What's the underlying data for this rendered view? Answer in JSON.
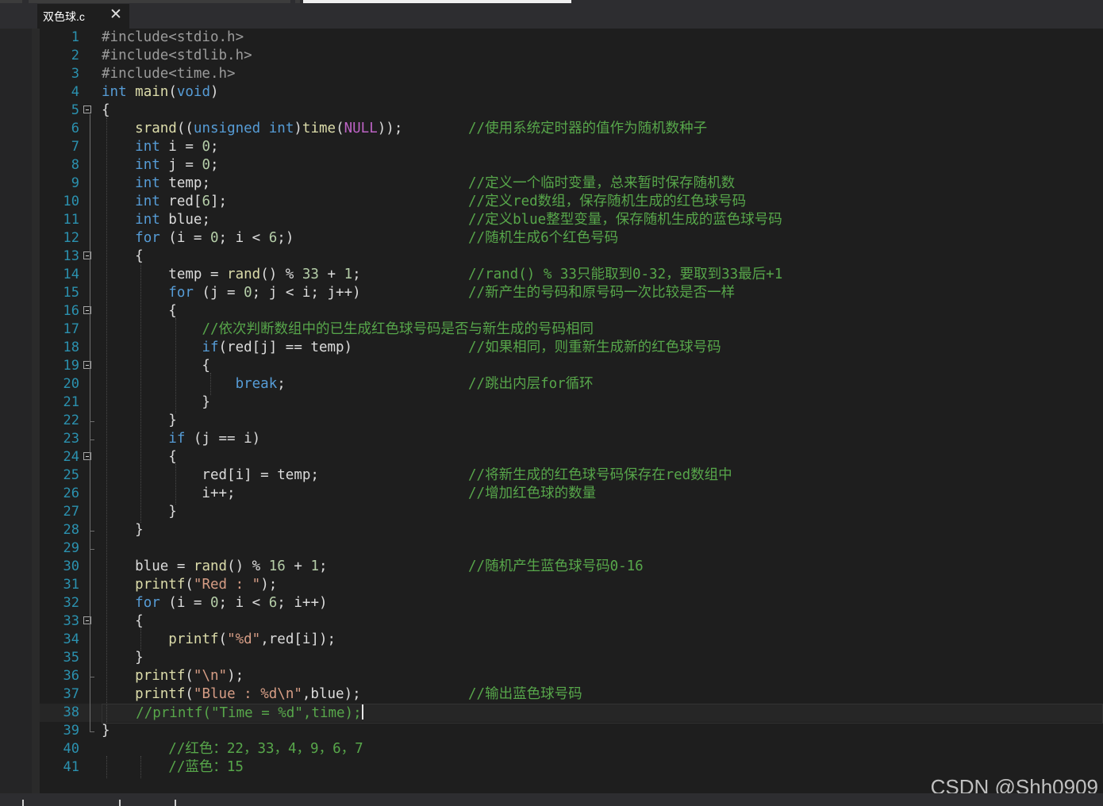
{
  "tab": {
    "label": "双色球.c",
    "close_icon": "close-icon"
  },
  "lines": [
    {
      "n": "1",
      "tokens": [
        [
          "pp",
          "#include<stdio.h>"
        ]
      ],
      "comment": ""
    },
    {
      "n": "2",
      "tokens": [
        [
          "pp",
          "#include<stdlib.h>"
        ]
      ],
      "comment": ""
    },
    {
      "n": "3",
      "tokens": [
        [
          "pp",
          "#include<time.h>"
        ]
      ],
      "comment": ""
    },
    {
      "n": "4",
      "tokens": [
        [
          "kw",
          "int"
        ],
        [
          "txt",
          " "
        ],
        [
          "fn",
          "main"
        ],
        [
          "txt",
          "("
        ],
        [
          "kw",
          "void"
        ],
        [
          "txt",
          ")"
        ]
      ],
      "comment": ""
    },
    {
      "n": "5",
      "tokens": [
        [
          "txt",
          "{"
        ]
      ],
      "comment": ""
    },
    {
      "n": "6",
      "tokens": [
        [
          "txt",
          "    "
        ],
        [
          "fn",
          "srand"
        ],
        [
          "txt",
          "(("
        ],
        [
          "kw",
          "unsigned int"
        ],
        [
          "txt",
          ")"
        ],
        [
          "fn",
          "time"
        ],
        [
          "txt",
          "("
        ],
        [
          "mac",
          "NULL"
        ],
        [
          "txt",
          "));"
        ]
      ],
      "comment": "//使用系统定时器的值作为随机数种子"
    },
    {
      "n": "7",
      "tokens": [
        [
          "txt",
          "    "
        ],
        [
          "kw",
          "int"
        ],
        [
          "txt",
          " i = "
        ],
        [
          "num",
          "0"
        ],
        [
          "txt",
          ";"
        ]
      ],
      "comment": ""
    },
    {
      "n": "8",
      "tokens": [
        [
          "txt",
          "    "
        ],
        [
          "kw",
          "int"
        ],
        [
          "txt",
          " j = "
        ],
        [
          "num",
          "0"
        ],
        [
          "txt",
          ";"
        ]
      ],
      "comment": ""
    },
    {
      "n": "9",
      "tokens": [
        [
          "txt",
          "    "
        ],
        [
          "kw",
          "int"
        ],
        [
          "txt",
          " temp;"
        ]
      ],
      "comment": "//定义一个临时变量，总来暂时保存随机数"
    },
    {
      "n": "10",
      "tokens": [
        [
          "txt",
          "    "
        ],
        [
          "kw",
          "int"
        ],
        [
          "txt",
          " red["
        ],
        [
          "num",
          "6"
        ],
        [
          "txt",
          "];"
        ]
      ],
      "comment": "//定义red数组，保存随机生成的红色球号码"
    },
    {
      "n": "11",
      "tokens": [
        [
          "txt",
          "    "
        ],
        [
          "kw",
          "int"
        ],
        [
          "txt",
          " blue;"
        ]
      ],
      "comment": "//定义blue整型变量，保存随机生成的蓝色球号码"
    },
    {
      "n": "12",
      "tokens": [
        [
          "txt",
          "    "
        ],
        [
          "kw",
          "for"
        ],
        [
          "txt",
          " (i = "
        ],
        [
          "num",
          "0"
        ],
        [
          "txt",
          "; i < "
        ],
        [
          "num",
          "6"
        ],
        [
          "txt",
          ";)"
        ]
      ],
      "comment": "//随机生成6个红色号码"
    },
    {
      "n": "13",
      "tokens": [
        [
          "txt",
          "    {"
        ]
      ],
      "comment": ""
    },
    {
      "n": "14",
      "tokens": [
        [
          "txt",
          "        temp = "
        ],
        [
          "fn",
          "rand"
        ],
        [
          "txt",
          "() % "
        ],
        [
          "num",
          "33"
        ],
        [
          "txt",
          " + "
        ],
        [
          "num",
          "1"
        ],
        [
          "txt",
          ";"
        ]
      ],
      "comment": "//rand() % 33只能取到0-32，要取到33最后+1"
    },
    {
      "n": "15",
      "tokens": [
        [
          "txt",
          "        "
        ],
        [
          "kw",
          "for"
        ],
        [
          "txt",
          " (j = "
        ],
        [
          "num",
          "0"
        ],
        [
          "txt",
          "; j < i; j++)"
        ]
      ],
      "comment": "//新产生的号码和原号码一次比较是否一样"
    },
    {
      "n": "16",
      "tokens": [
        [
          "txt",
          "        {"
        ]
      ],
      "comment": ""
    },
    {
      "n": "17",
      "tokens": [
        [
          "txt",
          "            "
        ],
        [
          "cm",
          "//依次判断数组中的已生成红色球号码是否与新生成的号码相同"
        ]
      ],
      "comment": ""
    },
    {
      "n": "18",
      "tokens": [
        [
          "txt",
          "            "
        ],
        [
          "kw",
          "if"
        ],
        [
          "txt",
          "(red[j] == temp)"
        ]
      ],
      "comment": "//如果相同，则重新生成新的红色球号码"
    },
    {
      "n": "19",
      "tokens": [
        [
          "txt",
          "            {"
        ]
      ],
      "comment": ""
    },
    {
      "n": "20",
      "tokens": [
        [
          "txt",
          "                "
        ],
        [
          "kw",
          "break"
        ],
        [
          "txt",
          ";"
        ]
      ],
      "comment": "//跳出内层for循环"
    },
    {
      "n": "21",
      "tokens": [
        [
          "txt",
          "            }"
        ]
      ],
      "comment": ""
    },
    {
      "n": "22",
      "tokens": [
        [
          "txt",
          "        }"
        ]
      ],
      "comment": ""
    },
    {
      "n": "23",
      "tokens": [
        [
          "txt",
          "        "
        ],
        [
          "kw",
          "if"
        ],
        [
          "txt",
          " (j == i)"
        ]
      ],
      "comment": ""
    },
    {
      "n": "24",
      "tokens": [
        [
          "txt",
          "        {"
        ]
      ],
      "comment": ""
    },
    {
      "n": "25",
      "tokens": [
        [
          "txt",
          "            red[i] = temp;"
        ]
      ],
      "comment": "//将新生成的红色球号码保存在red数组中"
    },
    {
      "n": "26",
      "tokens": [
        [
          "txt",
          "            i++;"
        ]
      ],
      "comment": "//增加红色球的数量"
    },
    {
      "n": "27",
      "tokens": [
        [
          "txt",
          "        }"
        ]
      ],
      "comment": ""
    },
    {
      "n": "28",
      "tokens": [
        [
          "txt",
          "    }"
        ]
      ],
      "comment": ""
    },
    {
      "n": "29",
      "tokens": [],
      "comment": ""
    },
    {
      "n": "30",
      "tokens": [
        [
          "txt",
          "    blue = "
        ],
        [
          "fn",
          "rand"
        ],
        [
          "txt",
          "() % "
        ],
        [
          "num",
          "16"
        ],
        [
          "txt",
          " + "
        ],
        [
          "num",
          "1"
        ],
        [
          "txt",
          ";"
        ]
      ],
      "comment": "//随机产生蓝色球号码0-16"
    },
    {
      "n": "31",
      "tokens": [
        [
          "txt",
          "    "
        ],
        [
          "fn",
          "printf"
        ],
        [
          "txt",
          "("
        ],
        [
          "str",
          "\"Red : \""
        ],
        [
          "txt",
          ");"
        ]
      ],
      "comment": ""
    },
    {
      "n": "32",
      "tokens": [
        [
          "txt",
          "    "
        ],
        [
          "kw",
          "for"
        ],
        [
          "txt",
          " (i = "
        ],
        [
          "num",
          "0"
        ],
        [
          "txt",
          "; i < "
        ],
        [
          "num",
          "6"
        ],
        [
          "txt",
          "; i++)"
        ]
      ],
      "comment": ""
    },
    {
      "n": "33",
      "tokens": [
        [
          "txt",
          "    {"
        ]
      ],
      "comment": ""
    },
    {
      "n": "34",
      "tokens": [
        [
          "txt",
          "        "
        ],
        [
          "fn",
          "printf"
        ],
        [
          "txt",
          "("
        ],
        [
          "str",
          "\"%d\""
        ],
        [
          "txt",
          ",red[i]);"
        ]
      ],
      "comment": ""
    },
    {
      "n": "35",
      "tokens": [
        [
          "txt",
          "    }"
        ]
      ],
      "comment": ""
    },
    {
      "n": "36",
      "tokens": [
        [
          "txt",
          "    "
        ],
        [
          "fn",
          "printf"
        ],
        [
          "txt",
          "("
        ],
        [
          "str",
          "\"\\n\""
        ],
        [
          "txt",
          ");"
        ]
      ],
      "comment": ""
    },
    {
      "n": "37",
      "tokens": [
        [
          "txt",
          "    "
        ],
        [
          "fn",
          "printf"
        ],
        [
          "txt",
          "("
        ],
        [
          "str",
          "\"Blue : %d\\n\""
        ],
        [
          "txt",
          ",blue);"
        ]
      ],
      "comment": "//输出蓝色球号码"
    },
    {
      "n": "38",
      "tokens": [
        [
          "txt",
          "    "
        ],
        [
          "cm",
          "//printf(\"Time = %d\",time);"
        ]
      ],
      "comment": "",
      "current": true
    },
    {
      "n": "39",
      "tokens": [
        [
          "txt",
          "}"
        ]
      ],
      "comment": ""
    },
    {
      "n": "40",
      "tokens": [
        [
          "txt",
          "        "
        ],
        [
          "cm",
          "//红色：22，33，4，9，6，7"
        ]
      ],
      "comment": ""
    },
    {
      "n": "41",
      "tokens": [
        [
          "txt",
          "        "
        ],
        [
          "cm",
          "//蓝色：15"
        ]
      ],
      "comment": ""
    }
  ],
  "watermark": "CSDN @Shh0909"
}
